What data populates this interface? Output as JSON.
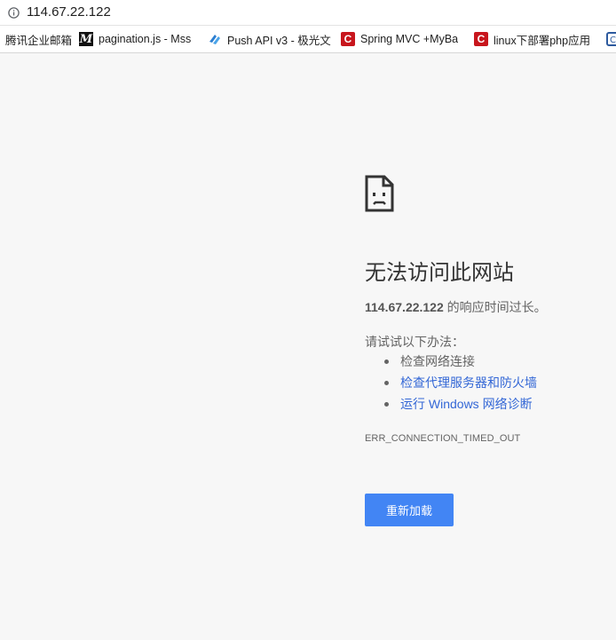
{
  "address_bar": {
    "url": "114.67.22.122",
    "icon": "info-icon"
  },
  "bookmarks": [
    {
      "label": "腾讯企业邮箱",
      "icon": "none"
    },
    {
      "label": "pagination.js - Mss",
      "icon": "m-logo-icon"
    },
    {
      "label": "Push API v3 - 极光文",
      "icon": "jpush-icon"
    },
    {
      "label": "Spring MVC +MyBa",
      "icon": "csdn-icon"
    },
    {
      "label": "linux下部署php应用",
      "icon": "csdn-icon"
    },
    {
      "label": "",
      "icon": "cnblogs-icon"
    }
  ],
  "error": {
    "icon": "sad-document-icon",
    "title": "无法访问此网站",
    "host": "114.67.22.122",
    "message": " 的响应时间过长。",
    "try_label": "请试试以下办法：",
    "suggestions": [
      {
        "text": "检查网络连接",
        "is_link": false
      },
      {
        "text": "检查代理服务器和防火墙",
        "is_link": true
      },
      {
        "text": "运行 Windows 网络诊断",
        "is_link": true
      }
    ],
    "code": "ERR_CONNECTION_TIMED_OUT",
    "reload_label": "重新加载"
  },
  "colors": {
    "background": "#f7f7f7",
    "link": "#3367d6",
    "button": "#4285f4",
    "csdn_red": "#c8161d"
  }
}
